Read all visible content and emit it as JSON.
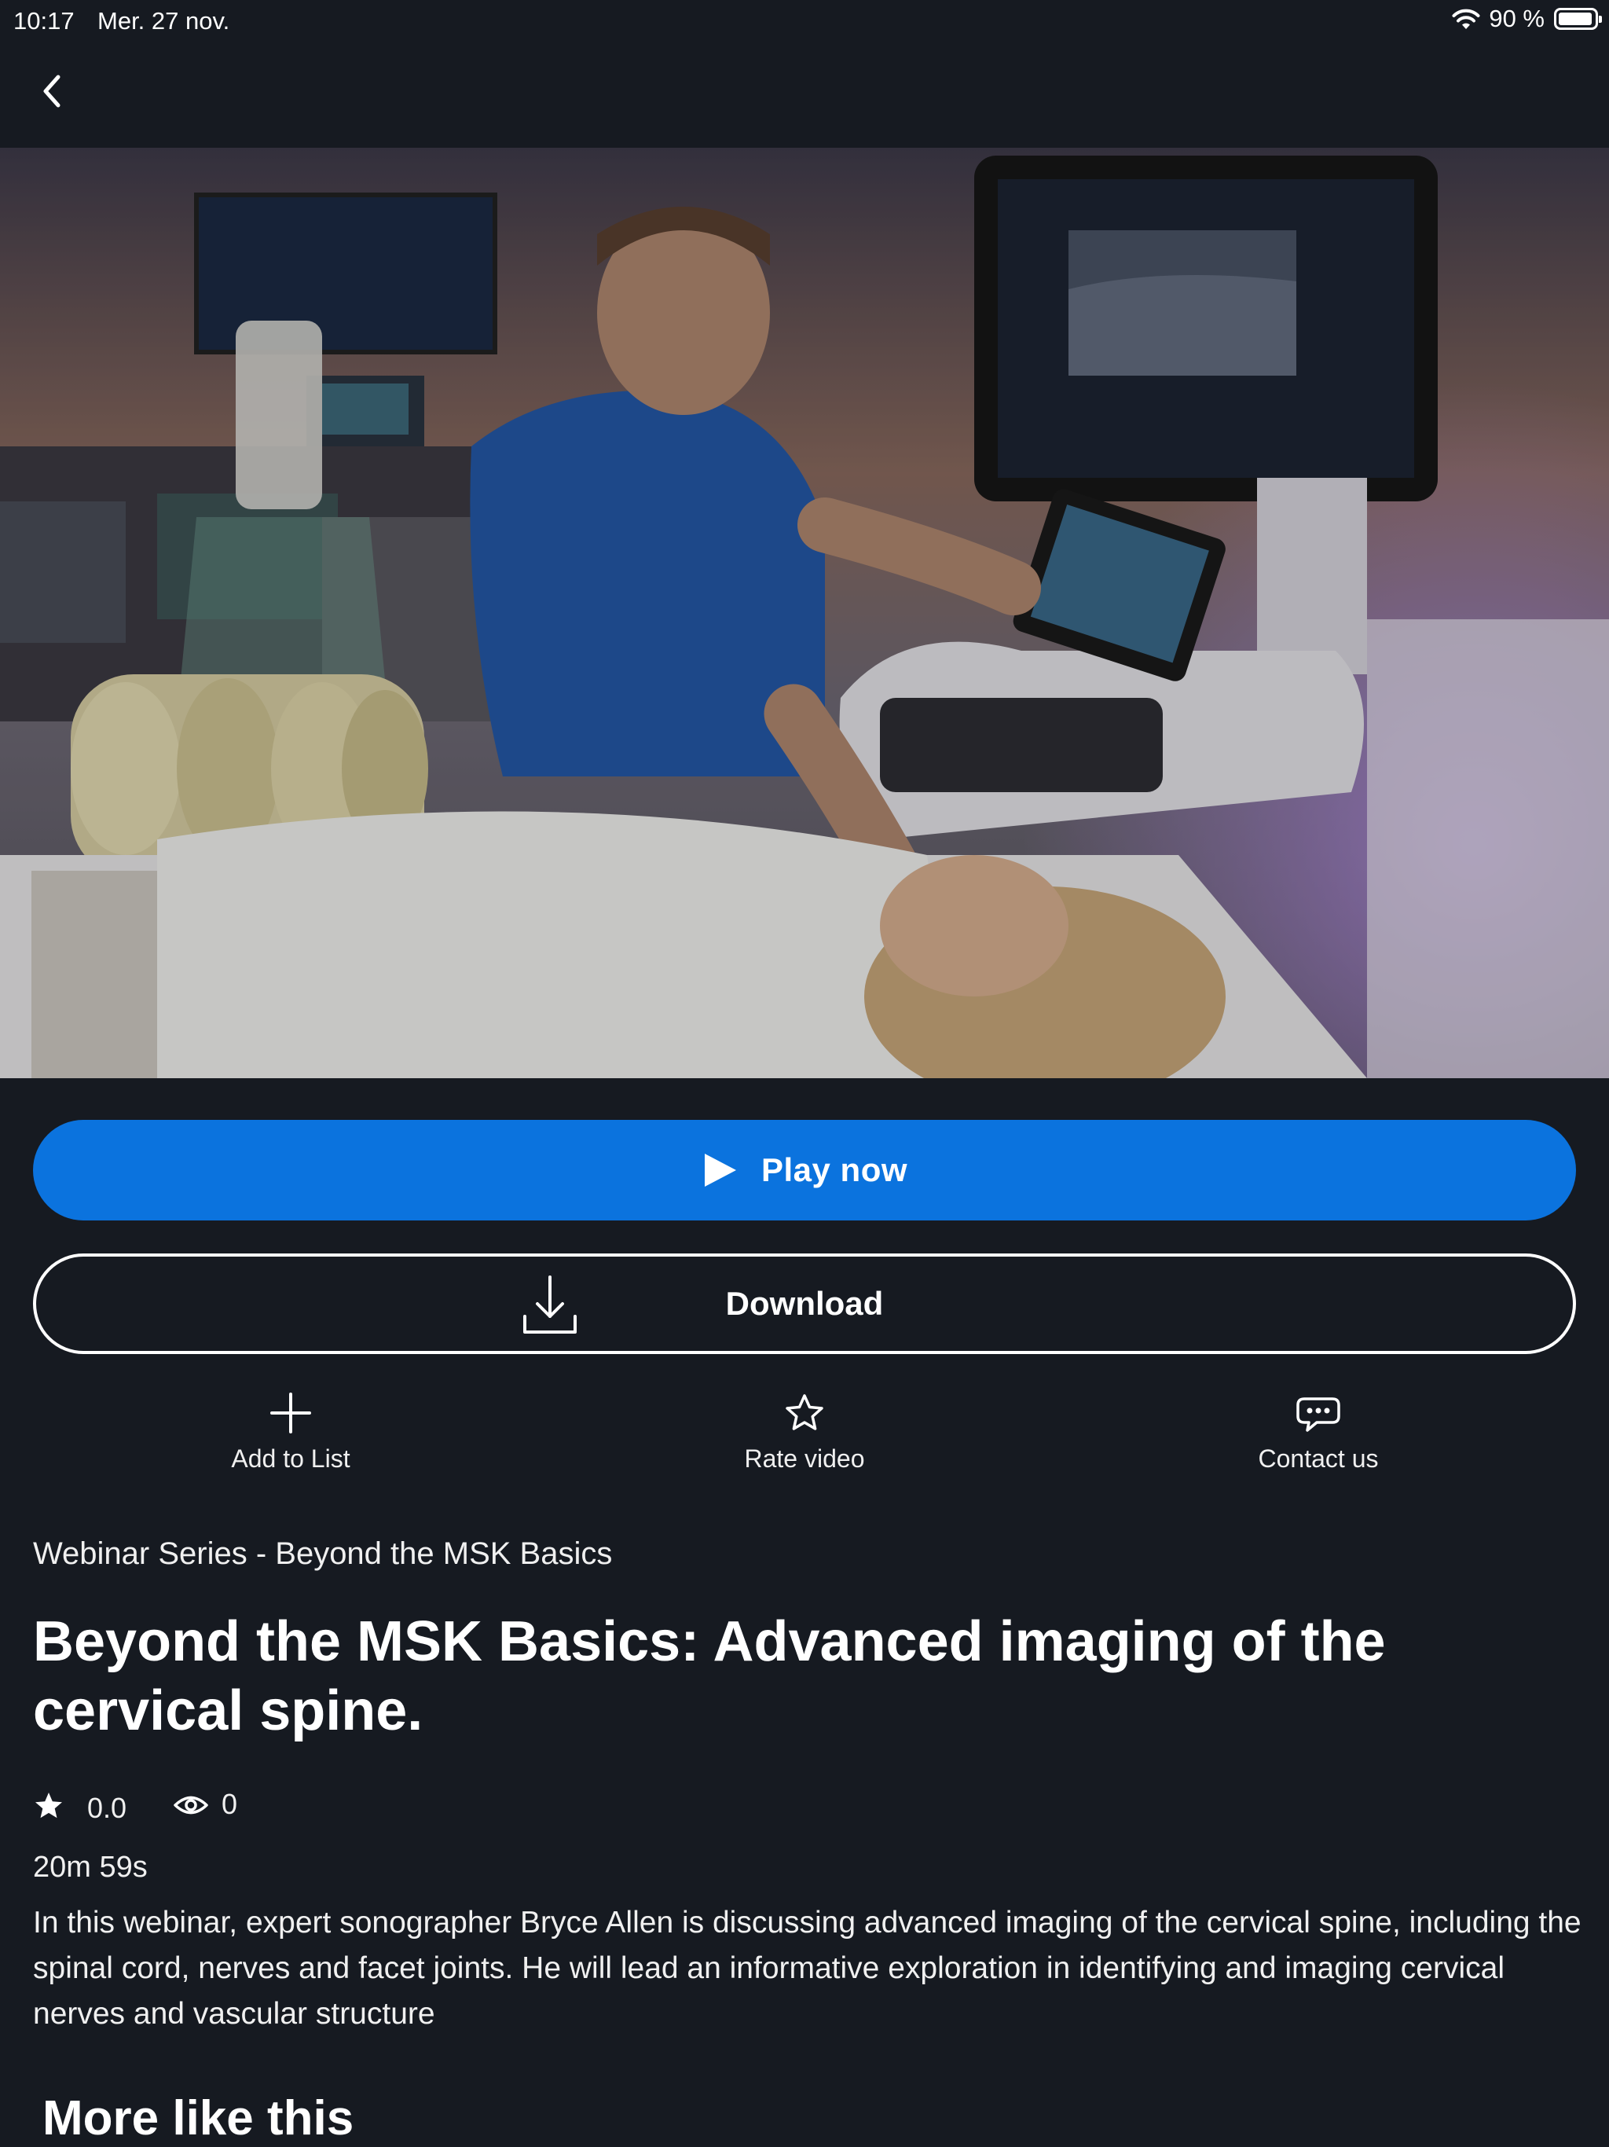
{
  "status_bar": {
    "time": "10:17",
    "date": "Mer. 27 nov.",
    "battery": "90 %"
  },
  "icons": {
    "back": "chevron-left-icon",
    "play": "play-icon",
    "download": "download-icon",
    "add": "plus-icon",
    "rate": "star-outline-icon",
    "contact": "chat-bubble-icon",
    "rating": "star-filled-icon",
    "views": "eye-icon"
  },
  "colors": {
    "background": "#161a21",
    "accent": "#0b73de",
    "text": "#ffffff"
  },
  "actions": {
    "play_label": "Play now",
    "download_label": "Download",
    "add_label": "Add to List",
    "rate_label": "Rate video",
    "contact_label": "Contact us"
  },
  "video": {
    "series": "Webinar Series - Beyond the MSK Basics",
    "title": "Beyond the MSK Basics: Advanced imaging of the cervical spine.",
    "rating": "0.0",
    "views": "0",
    "duration": "20m 59s",
    "description": "In this webinar, expert sonographer Bryce Allen is discussing advanced imaging of the cervical spine, including the spinal cord, nerves and facet joints. He will lead an informative exploration in identifying and imaging cervical nerves and vascular structure"
  },
  "more": {
    "title": "More like this"
  }
}
